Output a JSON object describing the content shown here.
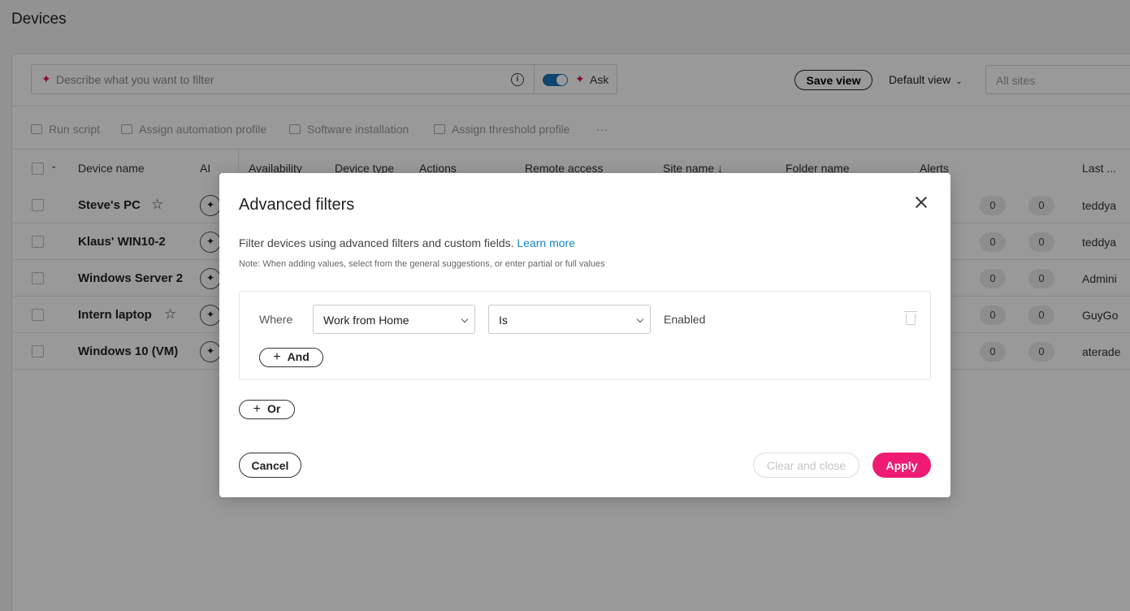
{
  "page": {
    "title": "Devices"
  },
  "toolbar": {
    "ai_placeholder": "Describe what you want to filter",
    "ask_label": "Ask",
    "save_view_label": "Save view",
    "default_view_label": "Default view",
    "sites_placeholder": "All sites"
  },
  "actions": {
    "run_script": "Run script",
    "assign_automation_profile": "Assign automation profile",
    "software_installation": "Software installation",
    "assign_threshold_profile": "Assign threshold profile",
    "more": "···"
  },
  "table": {
    "columns": [
      "Device name",
      "AI",
      "Availability",
      "Device type",
      "Actions",
      "Remote access",
      "Site name ↓",
      "Folder name",
      "Alerts",
      "Last ..."
    ],
    "rows": [
      {
        "name": "Steve's PC",
        "starred": true,
        "alerts": [
          "0",
          "0"
        ],
        "last": "teddya"
      },
      {
        "name": "Klaus' WIN10-2",
        "starred": false,
        "alerts": [
          "0",
          "0"
        ],
        "last": "teddya"
      },
      {
        "name": "Windows Server 2",
        "starred": false,
        "alerts": [
          "0",
          "0"
        ],
        "last": "Admini"
      },
      {
        "name": "Intern laptop",
        "starred": true,
        "alerts": [
          "0",
          "0"
        ],
        "last": "GuyGo"
      },
      {
        "name": "Windows 10 (VM)",
        "starred": false,
        "alerts": [
          "0",
          "0"
        ],
        "last": "aterade"
      }
    ]
  },
  "modal": {
    "title": "Advanced filters",
    "description": "Filter devices using advanced filters and custom fields.",
    "learn_more": "Learn more",
    "note": "Note: When adding values, select from the general suggestions, or enter partial or full values",
    "condition": {
      "where_label": "Where",
      "field": "Work from Home",
      "operator": "Is",
      "value": "Enabled"
    },
    "and_label": "And",
    "or_label": "Or",
    "cancel_label": "Cancel",
    "clear_label": "Clear and close",
    "apply_label": "Apply"
  },
  "colors": {
    "accent": "#ee1a74",
    "link": "#1a85c8",
    "toggle": "#1a73b8"
  }
}
